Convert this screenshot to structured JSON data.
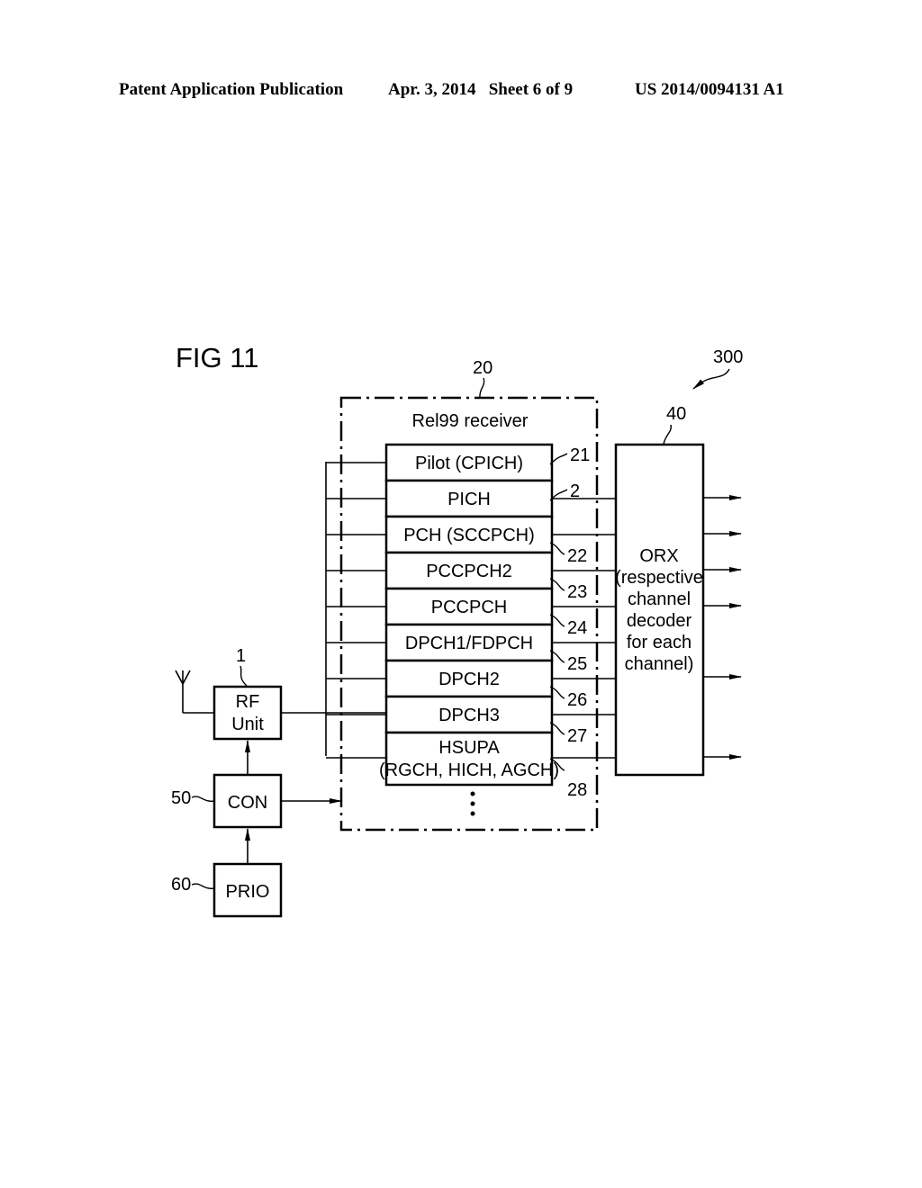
{
  "header": {
    "left": "Patent Application Publication",
    "middle": "Apr. 3, 2014   Sheet 6 of 9",
    "right": "US 2014/0094131 A1"
  },
  "figure": {
    "title": "FIG 11",
    "system_ref": "300",
    "receiver": {
      "ref": "20",
      "title": "Rel99 receiver",
      "channels": [
        {
          "label": "Pilot (CPICH)",
          "ref": "21"
        },
        {
          "label": "PICH",
          "ref": "2"
        },
        {
          "label": "PCH (SCCPCH)",
          "ref": "22"
        },
        {
          "label": "PCCPCH2",
          "ref": "23"
        },
        {
          "label": "PCCPCH",
          "ref": "24"
        },
        {
          "label": "DPCH1/FDPCH",
          "ref": "25"
        },
        {
          "label": "DPCH2",
          "ref": "26"
        },
        {
          "label": "DPCH3",
          "ref": "27"
        },
        {
          "label_line1": "HSUPA",
          "label_line2": "(RGCH, HICH, AGCH)",
          "ref": "28"
        }
      ],
      "continuation": "⋮"
    },
    "orx": {
      "ref": "40",
      "lines": [
        "ORX",
        "(respective",
        "channel",
        "decoder",
        "for each",
        "channel)"
      ]
    },
    "rf_unit": {
      "ref": "1",
      "line1": "RF",
      "line2": "Unit"
    },
    "con": {
      "ref": "50",
      "label": "CON"
    },
    "prio": {
      "ref": "60",
      "label": "PRIO"
    },
    "antenna": "antenna-icon"
  }
}
